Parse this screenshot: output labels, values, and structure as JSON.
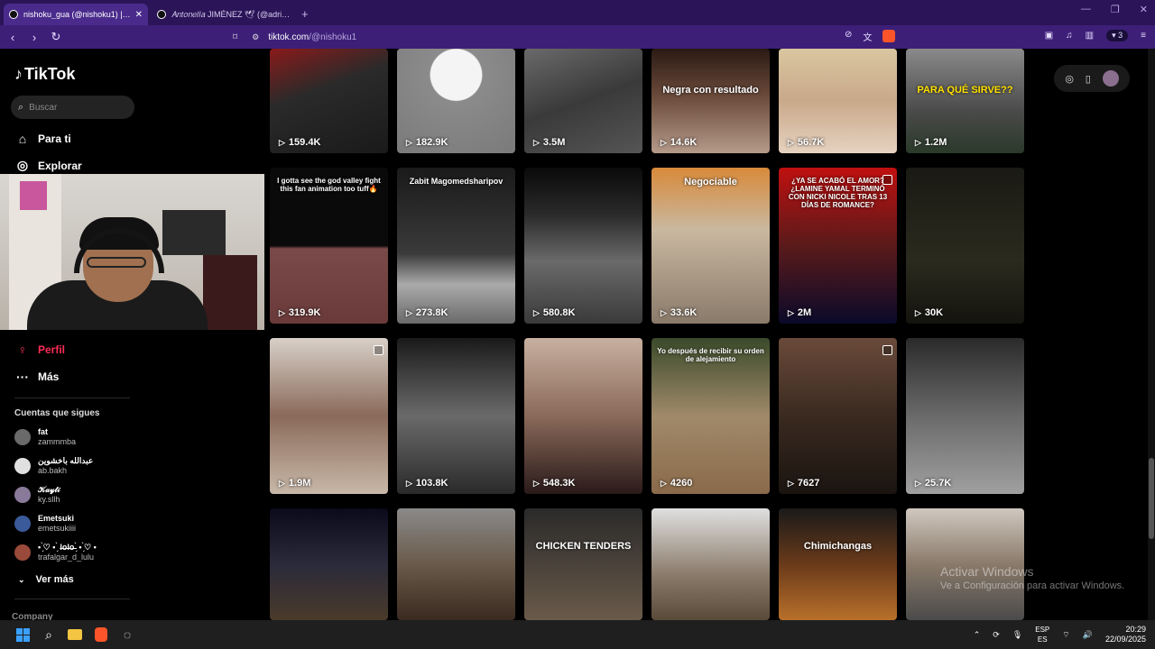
{
  "browser": {
    "tabs": [
      {
        "title": "nishoku_gua (@nishoku1) | TikTok",
        "active": true
      },
      {
        "title": "𝐴𝑛𝑡𝑜𝑛𝑒𝑙𝑙𝑎 JIMÉNEZ 🕊 (@adri_ch",
        "active": false
      }
    ],
    "new_tab": "+",
    "url_host": "tiktok.com",
    "url_path": "/@nishoku1",
    "wallet_count": "3"
  },
  "sidebar": {
    "logo": "TikTok",
    "search_placeholder": "Buscar",
    "nav": [
      {
        "label": "Para ti",
        "icon": "home-icon"
      },
      {
        "label": "Explorar",
        "icon": "compass-icon"
      },
      {
        "label": "Perfil",
        "icon": "profile-avatar-icon",
        "active": true
      },
      {
        "label": "Más",
        "icon": "more-dots-icon"
      }
    ],
    "following_title": "Cuentas que sigues",
    "following": [
      {
        "name": "fat",
        "handle": "zammmba",
        "color": "#6a6a6a"
      },
      {
        "name": "عبدالله باخشوين",
        "handle": "ab.bakh",
        "color": "#e0e0e0"
      },
      {
        "name": "𝒦𝒶𝓎𝓉𝒾",
        "handle": "ky.sllh",
        "color": "#8a7a9a"
      },
      {
        "name": "Emetsuki",
        "handle": "emetsukiiii",
        "color": "#3a5a9a"
      },
      {
        "name": "• ̗̀♡ • ̗̀ l̶o̶l̶o̶ ̗̀ • ̗̀♡ •",
        "handle": "trafalgar_d_lulu",
        "color": "#9a4a3a"
      }
    ],
    "ver_mas": "Ver más",
    "company": "Company"
  },
  "videos": [
    {
      "views": "159.4K",
      "bg": "linear-gradient(160deg,#8a1a1a 0%,#2a2a2a 40%,#1a1a1a 100%)"
    },
    {
      "views": "182.9K",
      "bg": "radial-gradient(circle at 50% 25%,#f4f4f4 0 26%,#8b8b8b 27%,#7a7a7a 100%)"
    },
    {
      "views": "3.5M",
      "bg": "linear-gradient(160deg,#6a6a6a 0%,#3a3a3a 50%,#555 100%)"
    },
    {
      "views": "14.6K",
      "bg": "linear-gradient(180deg,#2a1a14 0%,#6a4a3a 45%,#b59a8a 100%)",
      "overlay": "Negra con resultado"
    },
    {
      "views": "56.7K",
      "bg": "linear-gradient(180deg,#d9c6a0 0%,#c9a98a 50%,#e6d2c0 100%)"
    },
    {
      "views": "1.2M",
      "bg": "linear-gradient(180deg,#8a8a8a 0%,#4a4a4a 60%,#2a3a2a 100%)",
      "overlay": "PARA QUÉ SIRVE??",
      "overlay_color": "#ffe000"
    },
    {
      "views": "319.9K",
      "bg": "linear-gradient(180deg,#0a0a0a 0%,#0a0a0a 50%,#7a4a4a 52%,#6a3a3a 100%)",
      "overlay": "I gotta see the god valley fight this fan animation too tuff🔥"
    },
    {
      "views": "273.8K",
      "bg": "linear-gradient(180deg,#1a1a1a 0%,#3a3a3a 55%,#aaaaaa 75%,#6a6a6a 100%)",
      "overlay": "Zabit Magomedsharipov"
    },
    {
      "views": "580.8K",
      "bg": "linear-gradient(180deg,#0a0a0a 0%,#2a2a2a 30%,#6a6a6a 60%,#3a3a3a 100%)"
    },
    {
      "views": "33.6K",
      "bg": "linear-gradient(180deg,#d88a3a 0%,#c9b8a0 40%,#8a7a6a 100%)",
      "overlay": "Negociable"
    },
    {
      "views": "2M",
      "bg": "linear-gradient(180deg,#c01010 0%,#5a1a1a 50%,#0a0a2a 100%)",
      "overlay": "¿YA SE ACABÓ EL AMOR? ¿LAMINE YAMAL TERMINÓ CON NICKI NICOLE TRAS 13 DÍAS DE ROMANCE?"
    },
    {
      "views": "30K",
      "bg": "linear-gradient(180deg,#1a1a14 0%,#2a2a1e 60%,#14140e 100%)"
    },
    {
      "views": "1.9M",
      "bg": "linear-gradient(180deg,#d8d0c8 0%,#8a6a5a 50%,#c8b8a8 100%)"
    },
    {
      "views": "103.8K",
      "bg": "linear-gradient(180deg,#1a1a1a 0%,#6a6a6a 50%,#2a2a2a 100%)"
    },
    {
      "views": "548.3K",
      "bg": "linear-gradient(180deg,#c8b0a0 0%,#8a6a5a 50%,#2a1a1a 100%)"
    },
    {
      "views": "4260",
      "bg": "linear-gradient(180deg,#3a4a2a 0%,#a08a6a 50%,#8a6a4a 100%)",
      "overlay": "Yo después de recibir su orden de alejamiento"
    },
    {
      "views": "7627",
      "bg": "linear-gradient(180deg,#6a4a3a 0%,#3a2a20 50%,#1a1410 100%)"
    },
    {
      "views": "25.7K",
      "bg": "linear-gradient(180deg,#2a2a2a 0%,#6a6a6a 50%,#a0a0a0 100%)"
    },
    {
      "views": "",
      "bg": "linear-gradient(180deg,#0a0a1a 0%,#2a2a3a 50%,#4a3a2a 100%)"
    },
    {
      "views": "",
      "bg": "linear-gradient(180deg,#8a8a8a 0%,#6a5a4a 50%,#3a2a20 100%)"
    },
    {
      "views": "",
      "bg": "linear-gradient(180deg,#2a2a2a 0%,#6a5a4a 100%)",
      "overlay": "CHICKEN TENDERS"
    },
    {
      "views": "",
      "bg": "linear-gradient(180deg,#e0e0e0 0%,#8a7a6a 60%,#5a4a3a 100%)"
    },
    {
      "views": "",
      "bg": "linear-gradient(180deg,#1a1a1a 0%,#6a3a1a 50%,#b8702a 100%)",
      "overlay": "Chimichangas"
    },
    {
      "views": "",
      "bg": "linear-gradient(180deg,#d0c8c0 0%,#8a7a6a 50%,#4a4a4a 100%)"
    }
  ],
  "activation": {
    "line1": "Activar Windows",
    "line2": "Ve a Configuración para activar Windows."
  },
  "taskbar": {
    "lang_top": "ESP",
    "lang_bottom": "ES",
    "time": "20:29",
    "date": "22/09/2025"
  }
}
